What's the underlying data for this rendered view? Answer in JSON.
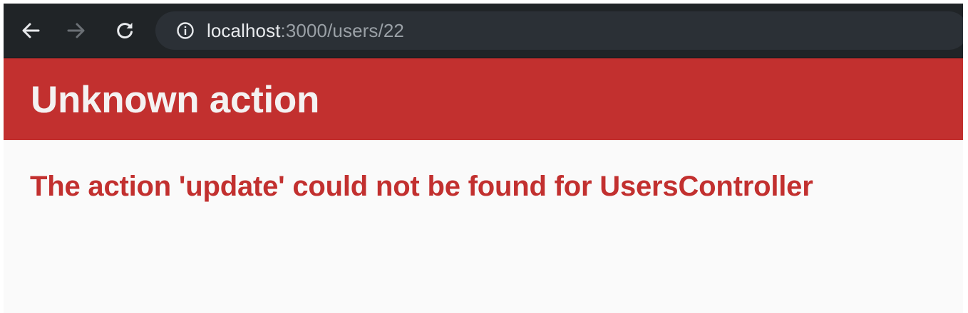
{
  "browser": {
    "url_host": "localhost",
    "url_path": ":3000/users/22",
    "icons": {
      "back": "arrow-left-icon",
      "forward": "arrow-right-icon",
      "reload": "reload-icon",
      "site_info": "info-circle-icon"
    }
  },
  "page": {
    "title": "Unknown action",
    "message": "The action 'update' could not be found for UsersController"
  },
  "colors": {
    "toolbar_bg": "#202427",
    "omnibox_bg": "#2b3036",
    "header_red": "#c2302f",
    "title_text": "#f4f2f2",
    "message_red": "#c2302f",
    "page_bg": "#fafafa"
  }
}
